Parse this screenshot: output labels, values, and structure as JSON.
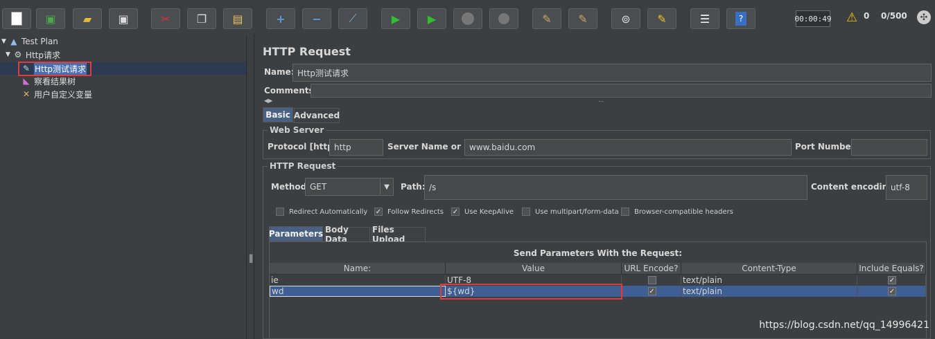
{
  "toolbar": {
    "buttons": [
      "new-icon",
      "templates-icon",
      "open-icon",
      "save-icon",
      "cut-icon",
      "copy-icon",
      "paste-icon",
      "expand-icon",
      "collapse-icon",
      "toggle-icon",
      "start-icon",
      "start-no-pause-icon",
      "stop-icon",
      "shutdown-icon",
      "clear-icon",
      "clear-all-icon",
      "search-icon",
      "reset-search-icon",
      "function-helper-icon",
      "help-icon"
    ],
    "timer": "00:00:49",
    "warning_count": "0",
    "threads": "0/500"
  },
  "tree": {
    "items": [
      {
        "label": "Test Plan",
        "icon": "test-plan-icon"
      },
      {
        "label": "Http请求",
        "icon": "thread-group-icon"
      },
      {
        "label": "Http测试请求",
        "icon": "sampler-icon"
      },
      {
        "label": "察看结果树",
        "icon": "listener-icon"
      },
      {
        "label": "用户自定义变量",
        "icon": "config-icon"
      }
    ]
  },
  "panel": {
    "title": "HTTP Request",
    "name_label": "Name:",
    "name_value": "Http测试请求",
    "comments_label": "Comments:",
    "tabs": [
      "Basic",
      "Advanced"
    ],
    "web_server": {
      "title": "Web Server",
      "protocol_label": "Protocol [http]:",
      "protocol_value": "http",
      "server_label": "Server Name or IP:",
      "server_value": "www.baidu.com",
      "port_label": "Port Number:",
      "port_value": ""
    },
    "http_request": {
      "title": "HTTP Request",
      "method_label": "Method:",
      "method_value": "GET",
      "path_label": "Path:",
      "path_value": "/s",
      "encoding_label": "Content encoding:",
      "encoding_value": "utf-8"
    },
    "checkboxes": [
      {
        "label": "Redirect Automatically",
        "checked": false
      },
      {
        "label": "Follow Redirects",
        "checked": true
      },
      {
        "label": "Use KeepAlive",
        "checked": true
      },
      {
        "label": "Use multipart/form-data",
        "checked": false
      },
      {
        "label": "Browser-compatible headers",
        "checked": false
      }
    ],
    "sub_tabs": [
      "Parameters",
      "Body Data",
      "Files Upload"
    ],
    "params": {
      "caption": "Send Parameters With the Request:",
      "columns": [
        "Name:",
        "Value",
        "URL Encode?",
        "Content-Type",
        "Include Equals?"
      ],
      "rows": [
        {
          "name": "ie",
          "value": "UTF-8",
          "url_encode": false,
          "content_type": "text/plain",
          "include_equals": true
        },
        {
          "name": "wd",
          "value": "${wd}",
          "url_encode": true,
          "content_type": "text/plain",
          "include_equals": true
        }
      ]
    }
  },
  "watermark": "https://blog.csdn.net/qq_14996421"
}
